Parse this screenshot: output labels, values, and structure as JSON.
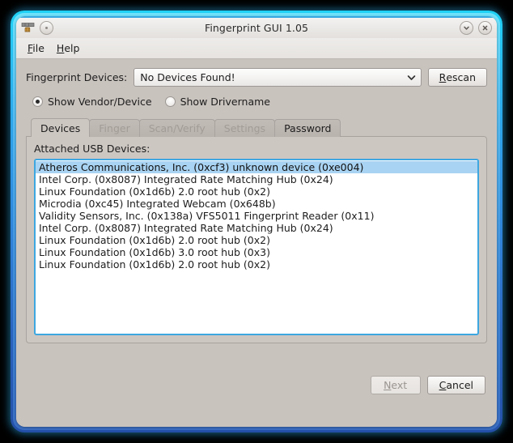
{
  "window": {
    "title": "Fingerprint GUI 1.05",
    "app_icon": "fingerprint-scanner-icon",
    "menu_button_icon": "window-menu-icon",
    "shade_button_icon": "chevron-down-icon",
    "close_button_icon": "close-icon",
    "accent_color": "#35a8e0",
    "background_color": "#c9c3be"
  },
  "menubar": {
    "items": [
      {
        "label": "File",
        "mnemonic": "F"
      },
      {
        "label": "Help",
        "mnemonic": "H"
      }
    ]
  },
  "device_row": {
    "label": "Fingerprint Devices:",
    "combo": {
      "value": "No Devices Found!",
      "icon": "chevron-down-icon"
    },
    "rescan_button": {
      "label_pre": "",
      "mnemonic": "R",
      "label_post": "escan",
      "enabled": true
    }
  },
  "display_mode": {
    "options": [
      {
        "label": "Show Vendor/Device",
        "selected": true
      },
      {
        "label": "Show Drivername",
        "selected": false
      }
    ]
  },
  "tabs": [
    {
      "label": "Devices",
      "active": true,
      "enabled": true
    },
    {
      "label": "Finger",
      "active": false,
      "enabled": false
    },
    {
      "label": "Scan/Verify",
      "active": false,
      "enabled": false
    },
    {
      "label": "Settings",
      "active": false,
      "enabled": false
    },
    {
      "label": "Password",
      "active": false,
      "enabled": true
    }
  ],
  "devices_tab": {
    "list_label": "Attached USB Devices:",
    "selection_color": "#a9d3f2",
    "focus_border_color": "#3ea7e0",
    "items": [
      {
        "text": "Atheros Communications, Inc. (0xcf3) unknown device (0xe004)",
        "selected": true
      },
      {
        "text": "Intel Corp. (0x8087) Integrated Rate Matching Hub (0x24)",
        "selected": false
      },
      {
        "text": "Linux Foundation (0x1d6b) 2.0 root hub (0x2)",
        "selected": false
      },
      {
        "text": "Microdia (0xc45) Integrated Webcam (0x648b)",
        "selected": false
      },
      {
        "text": "Validity Sensors, Inc. (0x138a) VFS5011 Fingerprint Reader (0x11)",
        "selected": false
      },
      {
        "text": "Intel Corp. (0x8087) Integrated Rate Matching Hub (0x24)",
        "selected": false
      },
      {
        "text": "Linux Foundation (0x1d6b) 2.0 root hub (0x2)",
        "selected": false
      },
      {
        "text": "Linux Foundation (0x1d6b) 3.0 root hub (0x3)",
        "selected": false
      },
      {
        "text": "Linux Foundation (0x1d6b) 2.0 root hub (0x2)",
        "selected": false
      }
    ]
  },
  "actions": {
    "next_button": {
      "label_pre": "",
      "mnemonic": "N",
      "label_post": "ext",
      "enabled": false
    },
    "cancel_button": {
      "label_pre": "",
      "mnemonic": "C",
      "label_post": "ancel",
      "enabled": true
    }
  }
}
